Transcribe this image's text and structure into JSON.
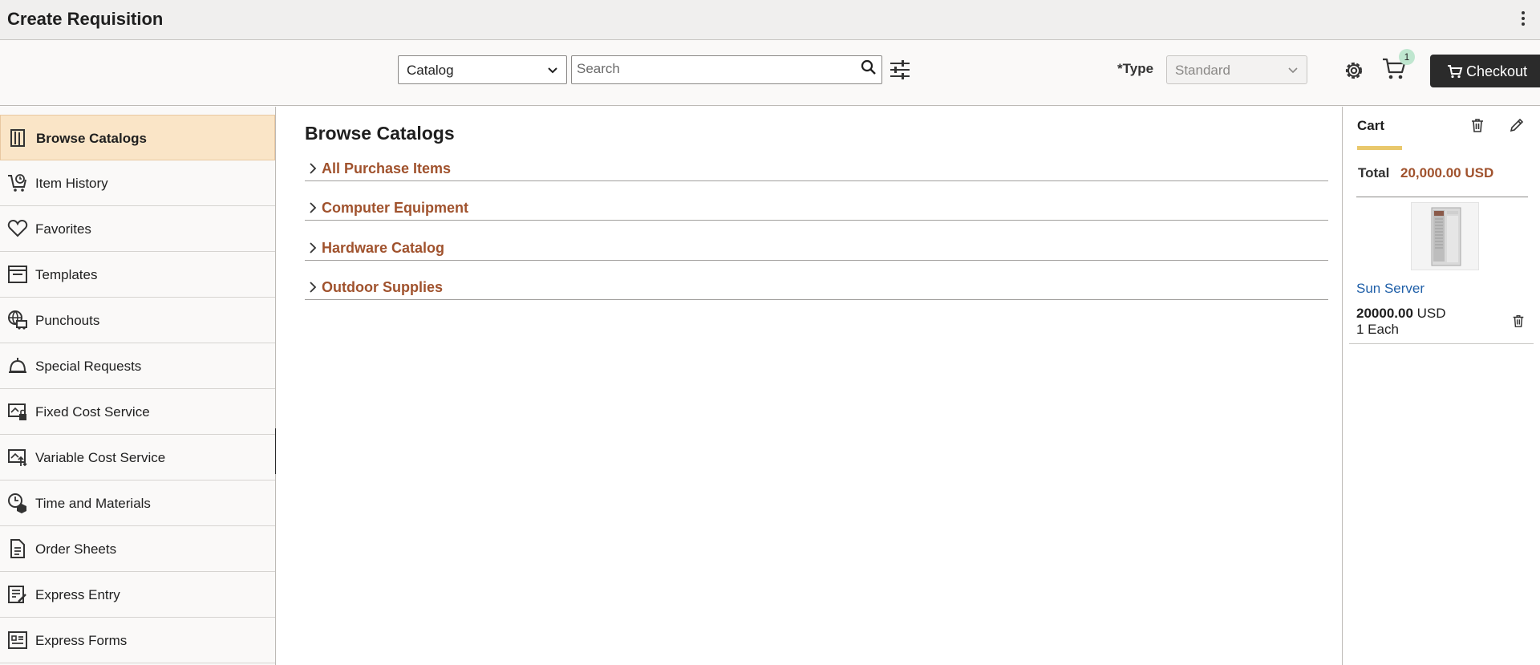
{
  "header": {
    "title": "Create Requisition",
    "actions_icon": "kebab-menu-icon"
  },
  "toolbar": {
    "search_scope": "Catalog",
    "search_placeholder": "Search",
    "type_label": "*Type",
    "type_value": "Standard",
    "cart_count": "1",
    "checkout_label": "Checkout"
  },
  "sidebar": {
    "active_index": 0,
    "items": [
      {
        "label": "Browse Catalogs",
        "icon": "book-icon"
      },
      {
        "label": "Item History",
        "icon": "cart-history-icon"
      },
      {
        "label": "Favorites",
        "icon": "heart-icon"
      },
      {
        "label": "Templates",
        "icon": "template-icon"
      },
      {
        "label": "Punchouts",
        "icon": "punchout-icon"
      },
      {
        "label": "Special Requests",
        "icon": "bell-icon"
      },
      {
        "label": "Fixed Cost Service",
        "icon": "fixed-cost-icon"
      },
      {
        "label": "Variable Cost Service",
        "icon": "variable-cost-icon"
      },
      {
        "label": "Time and Materials",
        "icon": "time-materials-icon"
      },
      {
        "label": "Order Sheets",
        "icon": "document-icon"
      },
      {
        "label": "Express Entry",
        "icon": "express-entry-icon"
      },
      {
        "label": "Express Forms",
        "icon": "express-forms-icon"
      }
    ]
  },
  "main": {
    "title": "Browse Catalogs",
    "catalogs": [
      {
        "label": "All Purchase Items"
      },
      {
        "label": "Computer Equipment"
      },
      {
        "label": "Hardware Catalog"
      },
      {
        "label": "Outdoor Supplies"
      }
    ]
  },
  "cart": {
    "title": "Cart",
    "total_label": "Total",
    "total_value": "20,000.00 USD",
    "items": [
      {
        "name": "Sun Server",
        "price": "20000.00",
        "currency": "USD",
        "quantity": "1 Each"
      }
    ]
  },
  "colors": {
    "accent": "#a0522d",
    "active_nav": "#fae5c7",
    "checkout_bg": "#2b2b2b",
    "link": "#1f5fa8",
    "cart_underline": "#e9c86c",
    "badge": "#bfe6cf"
  }
}
